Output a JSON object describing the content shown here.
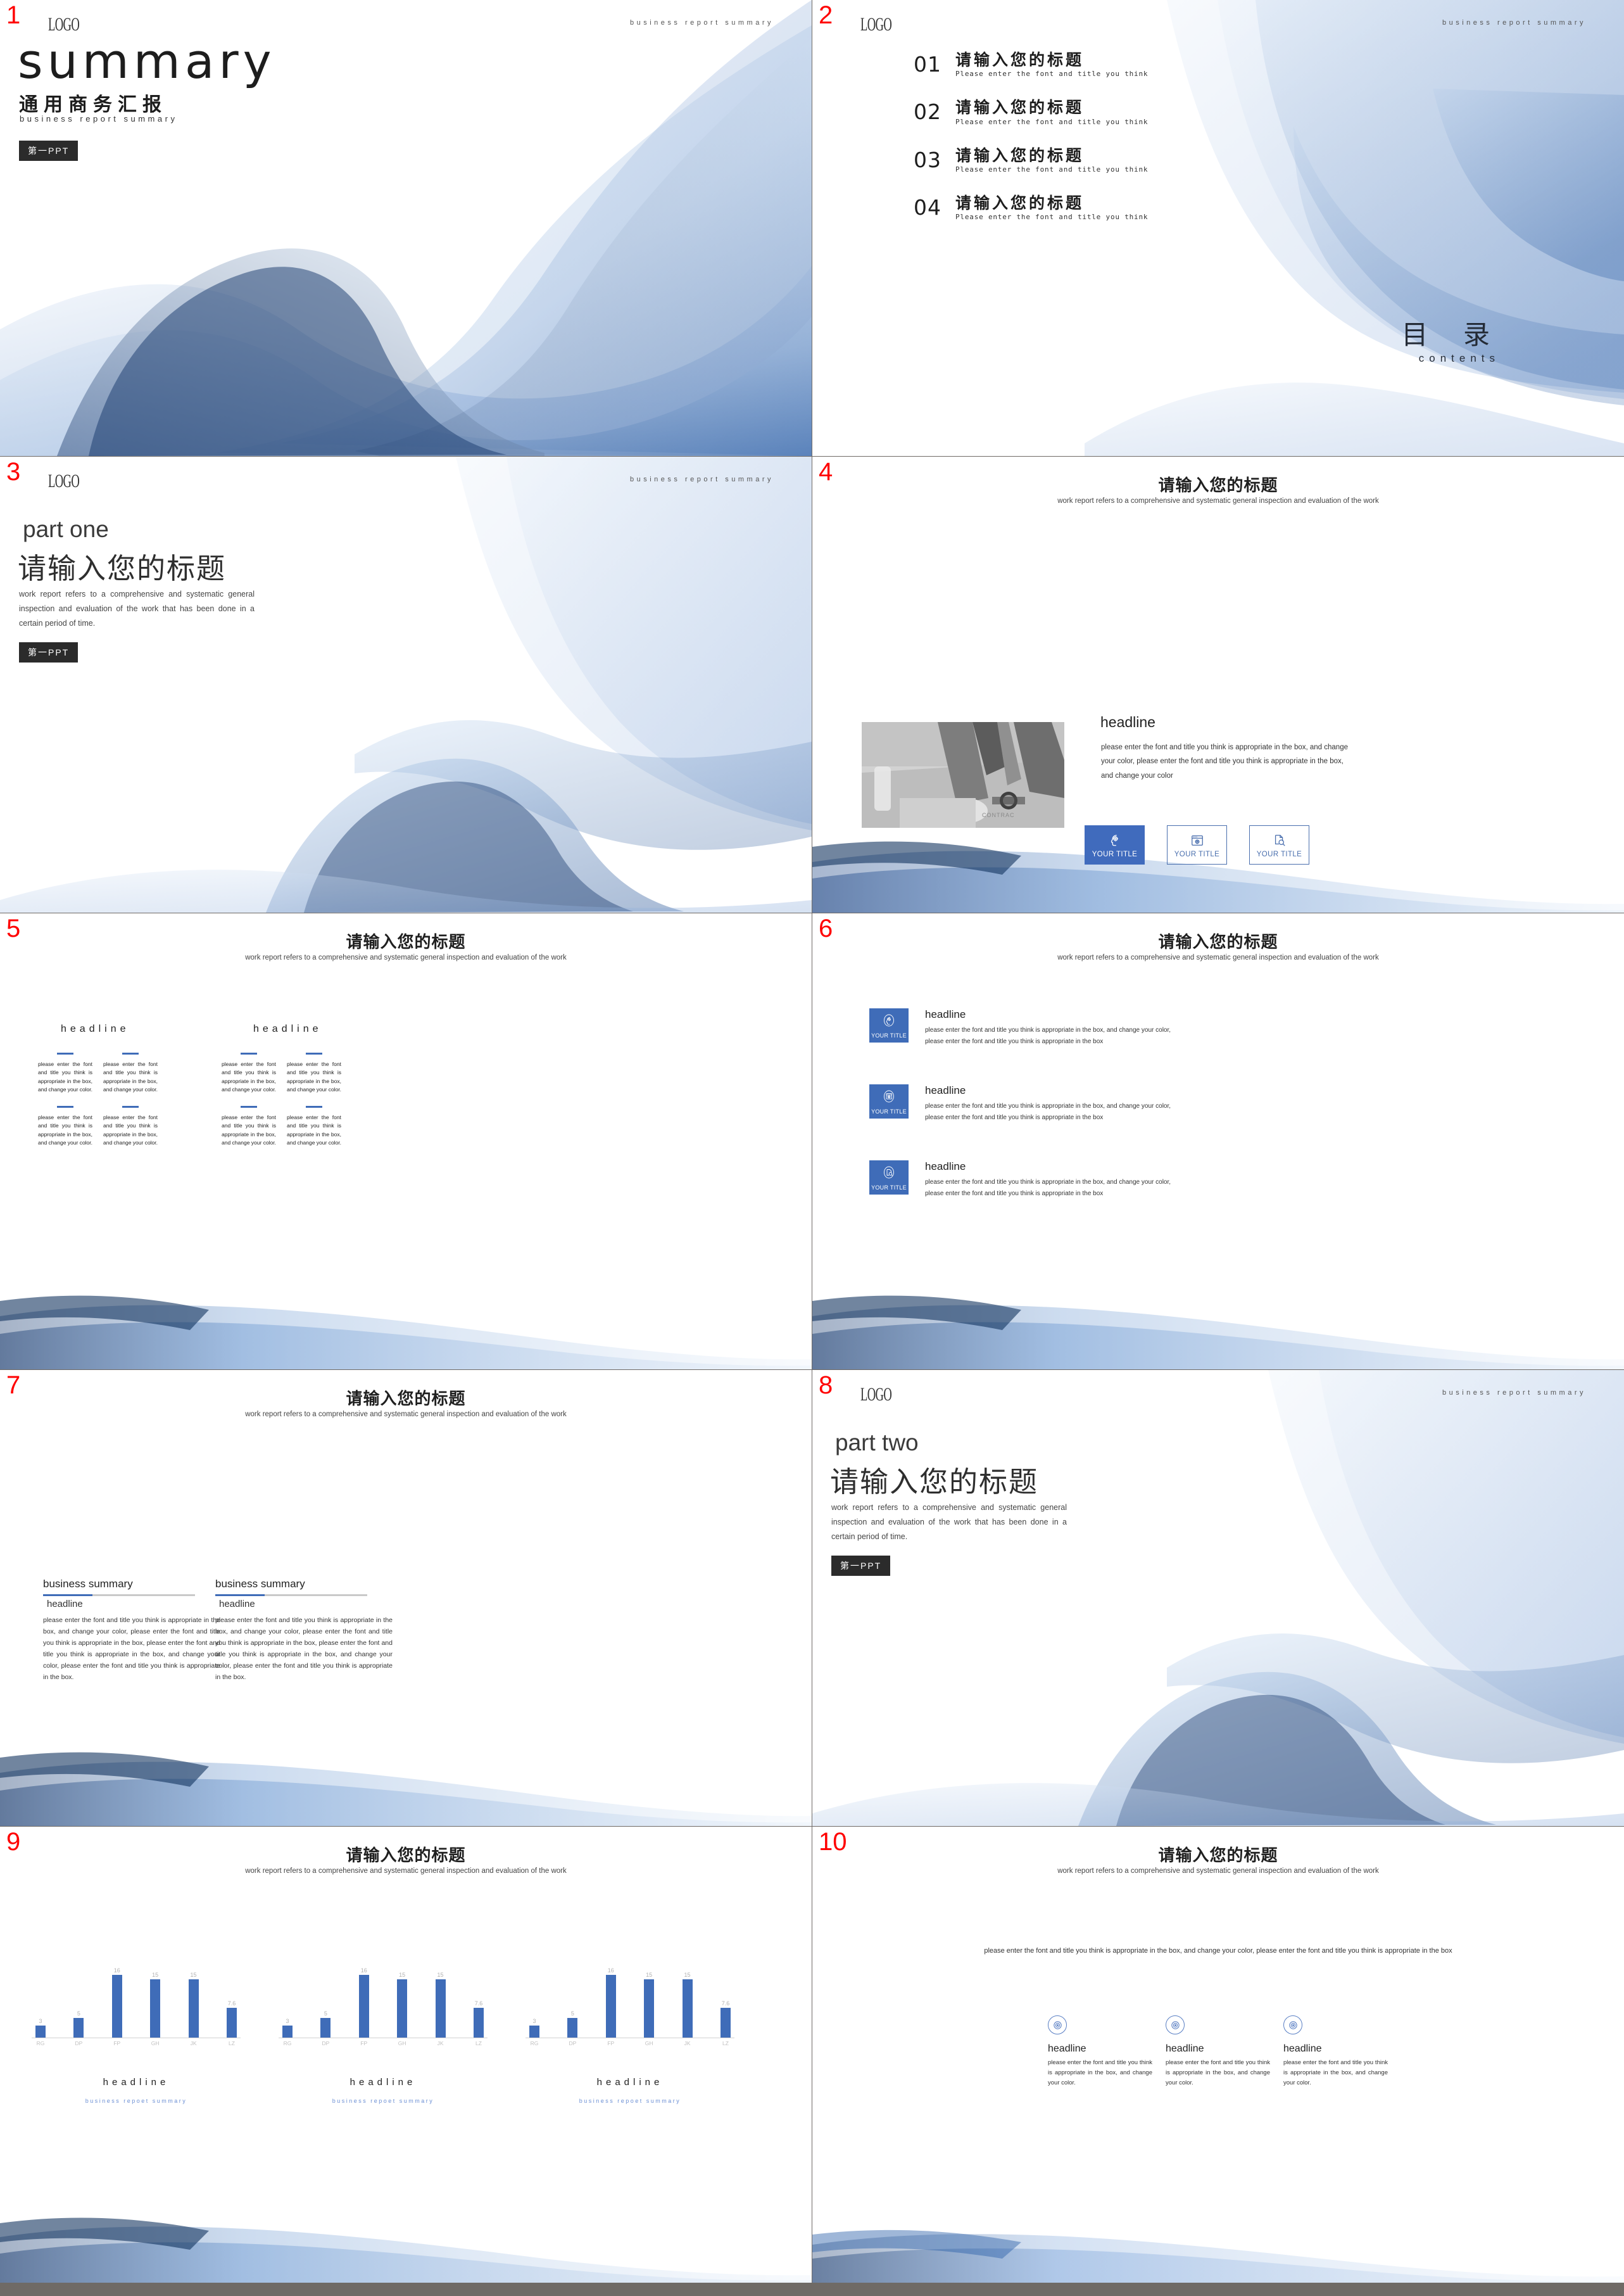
{
  "brand": {
    "logo": "LOGO",
    "header_tagline": "business report summary",
    "badge": "第一PPT",
    "accent": "#3f6cb8",
    "accent_dark": "#2f5aa8",
    "number_color": "#ff0000"
  },
  "slide1": {
    "number": "1",
    "title": "summary",
    "subtitle_cn": "通用商务汇报",
    "subtitle_en": "business report summary"
  },
  "slide2": {
    "number": "2",
    "contents_cn": "目 录",
    "contents_en": "contents",
    "items": [
      {
        "num": "01",
        "cn": "请输入您的标题",
        "en": "Please enter the font and title you think"
      },
      {
        "num": "02",
        "cn": "请输入您的标题",
        "en": "Please enter the font and title you think"
      },
      {
        "num": "03",
        "cn": "请输入您的标题",
        "en": "Please enter the font and title you think"
      },
      {
        "num": "04",
        "cn": "请输入您的标题",
        "en": "Please enter the font and title you think"
      }
    ]
  },
  "slide3": {
    "number": "3",
    "part_en": "part one",
    "part_cn": "请输入您的标题",
    "body": "work report refers to a comprehensive and systematic general inspection and evaluation of the work that has been done in a certain period of time."
  },
  "slide4": {
    "number": "4",
    "title_cn": "请输入您的标题",
    "subtitle_en": "work report refers to a comprehensive and systematic general inspection and evaluation of the work",
    "headline": "headline",
    "body": "please enter the font and title you think is appropriate in the box, and change your color, please enter the font and title you think is appropriate in the box, and change your color",
    "tiles": [
      {
        "icon": "head-gear-icon",
        "label": "YOUR TITLE",
        "filled": true
      },
      {
        "icon": "browser-gear-icon",
        "label": "YOUR TITLE",
        "filled": false
      },
      {
        "icon": "document-search-icon",
        "label": "YOUR TITLE",
        "filled": false
      }
    ]
  },
  "slide5": {
    "number": "5",
    "title_cn": "请输入您的标题",
    "subtitle_en": "work report refers to a comprehensive and systematic general inspection and evaluation of the work",
    "headline_left": "headline",
    "headline_right": "headline",
    "para": "please enter the font and title you think is appropriate in the box, and change your color.",
    "columns": 4,
    "paras_per_column": 2
  },
  "slide6": {
    "number": "6",
    "title_cn": "请输入您的标题",
    "subtitle_en": "work report refers to a comprehensive and systematic general inspection and evaluation of the work",
    "rows": [
      {
        "tile_label": "YOUR TITLE",
        "icon": "head-gear-icon",
        "headline": "headline",
        "body": "please enter the font and title you think is appropriate in the box, and change your color, please enter the font and title you think is appropriate in the box"
      },
      {
        "tile_label": "YOUR TITLE",
        "icon": "browser-gear-icon",
        "headline": "headline",
        "body": "please enter the font and title you think is appropriate in the box, and change your color, please enter the font and title you think is appropriate in the box"
      },
      {
        "tile_label": "YOUR TITLE",
        "icon": "document-search-icon",
        "headline": "headline",
        "body": "please enter the font and title you think is appropriate in the box, and change your color, please enter the font and title you think is appropriate in the box"
      }
    ]
  },
  "slide7": {
    "number": "7",
    "title_cn": "请输入您的标题",
    "subtitle_en": "work report refers to a comprehensive and systematic general inspection and evaluation of the work",
    "columns": [
      {
        "title": "business summary",
        "sub": "headline",
        "body": "please enter the font and title you think is appropriate in the box, and change your color, please enter the font and title you think is appropriate in the box, please enter the font and title you think is appropriate in the box, and change your color, please enter the font and title you think is appropriate in the box."
      },
      {
        "title": "business summary",
        "sub": "headline",
        "body": "please enter the font and title you think is appropriate in the box, and change your color, please enter the font and title you think is appropriate in the box, please enter the font and title you think is appropriate in the box, and change your color, please enter the font and title you think is appropriate in the box."
      }
    ]
  },
  "slide8": {
    "number": "8",
    "part_en": "part two",
    "part_cn": "请输入您的标题",
    "body": "work report refers to a comprehensive and systematic general inspection and evaluation of the work that has been done in a certain period of time."
  },
  "slide9": {
    "number": "9",
    "title_cn": "请输入您的标题",
    "subtitle_en": "work report refers to a comprehensive and systematic general inspection and evaluation of the work",
    "captions": [
      {
        "headline": "headline",
        "sub": "business repoet summary"
      },
      {
        "headline": "headline",
        "sub": "business repoet summary"
      },
      {
        "headline": "headline",
        "sub": "business repoet summary"
      }
    ]
  },
  "slide10": {
    "number": "10",
    "title_cn": "请输入您的标题",
    "subtitle_en": "work report refers to a comprehensive and systematic general inspection and evaluation of the work",
    "lead": "please enter the font and title you think is appropriate in the box, and change your color, please enter the font and title you think is appropriate in the box",
    "columns": [
      {
        "icon": "target-icon",
        "headline": "headline",
        "body": "please enter the font and title you think is appropriate in the box, and change your color."
      },
      {
        "icon": "target-icon",
        "headline": "headline",
        "body": "please enter the font and title you think is appropriate in the box, and change your color."
      },
      {
        "icon": "target-icon",
        "headline": "headline",
        "body": "please enter the font and title you think is appropriate in the box, and change your color."
      }
    ]
  },
  "chart_data": [
    {
      "type": "bar",
      "title": "headline",
      "subtitle": "business repoet summary",
      "categories": [
        "RG",
        "DP",
        "FP",
        "GH",
        "JK",
        "LZ"
      ],
      "values": [
        3,
        5,
        16,
        15,
        15,
        7.6
      ],
      "xlabel": "",
      "ylabel": "",
      "ylim": [
        0,
        18
      ],
      "grid": false,
      "legend": "none",
      "series_color": "#3f6cb8"
    },
    {
      "type": "bar",
      "title": "headline",
      "subtitle": "business repoet summary",
      "categories": [
        "RG",
        "DP",
        "FP",
        "GH",
        "JK",
        "LZ"
      ],
      "values": [
        3,
        5,
        16,
        15,
        15,
        7.6
      ],
      "xlabel": "",
      "ylabel": "",
      "ylim": [
        0,
        18
      ],
      "grid": false,
      "legend": "none",
      "series_color": "#3f6cb8"
    },
    {
      "type": "bar",
      "title": "headline",
      "subtitle": "business repoet summary",
      "categories": [
        "RG",
        "DP",
        "FP",
        "GH",
        "JK",
        "LZ"
      ],
      "values": [
        3,
        5,
        16,
        15,
        15,
        7.6
      ],
      "xlabel": "",
      "ylabel": "",
      "ylim": [
        0,
        18
      ],
      "grid": false,
      "legend": "none",
      "series_color": "#3f6cb8"
    }
  ]
}
